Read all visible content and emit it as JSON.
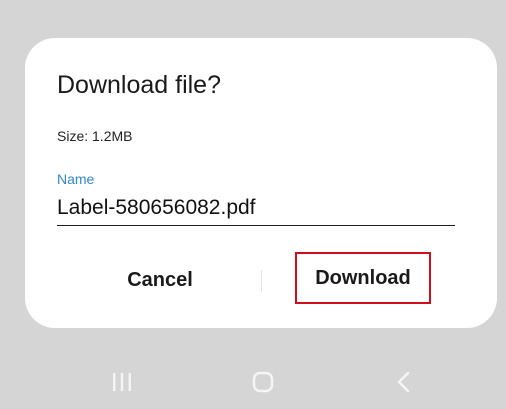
{
  "dialog": {
    "title": "Download file?",
    "size_text": "Size: 1.2MB",
    "name_label": "Name",
    "name_value": "Label-580656082.pdf",
    "cancel_label": "Cancel",
    "download_label": "Download"
  },
  "navbar": {
    "recents_icon": "recents-icon",
    "home_icon": "home-icon",
    "back_icon": "back-icon"
  },
  "colors": {
    "background": "#d5d5d5",
    "dialog": "#ffffff",
    "accent_label": "#2f86d1",
    "highlight_border": "#d10d1e",
    "nav_icon": "#f5f5f5"
  }
}
